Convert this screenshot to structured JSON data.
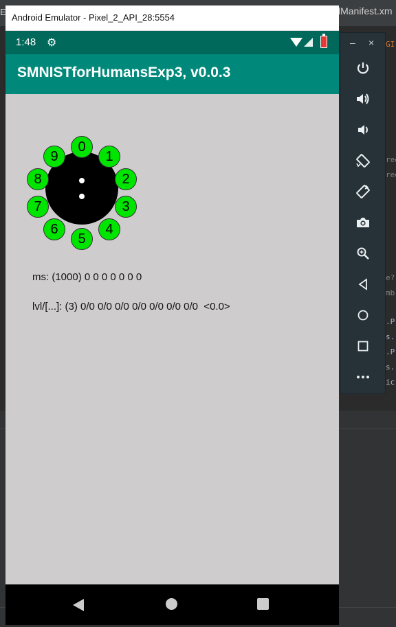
{
  "ide": {
    "left_fragment": "E",
    "tab_label": "lManifest.xm",
    "code_fragments": [
      "GI",
      "ree",
      "ree",
      "e?",
      "mb",
      ".P",
      "s.",
      ".P",
      "s.",
      "ic"
    ]
  },
  "window": {
    "title": "Android Emulator - Pixel_2_API_28:5554"
  },
  "status_bar": {
    "time": "1:48",
    "settings_icon": "gear-icon"
  },
  "app": {
    "title": "SMNISTforHumansExp3, v0.0.3"
  },
  "dial": {
    "buttons": [
      {
        "label": "0"
      },
      {
        "label": "1"
      },
      {
        "label": "2"
      },
      {
        "label": "3"
      },
      {
        "label": "4"
      },
      {
        "label": "5"
      },
      {
        "label": "6"
      },
      {
        "label": "7"
      },
      {
        "label": "8"
      },
      {
        "label": "9"
      }
    ],
    "colors": {
      "button": "#00e500",
      "center": "#000000"
    }
  },
  "stats": {
    "ms_line": "ms: (1000) 0 0 0 0 0 0 0",
    "lvl_line": "lvl/[...]: (3) 0/0 0/0 0/0 0/0 0/0 0/0 0/0  <0.0>"
  },
  "toolbar": {
    "minimize": "–",
    "close": "×",
    "buttons": [
      "power-icon",
      "volume-up-icon",
      "volume-down-icon",
      "rotate-left-icon",
      "rotate-right-icon",
      "camera-icon",
      "zoom-icon",
      "back-icon",
      "home-icon",
      "overview-icon",
      "more-icon"
    ]
  },
  "colors": {
    "status_bar": "#00695c",
    "app_bar": "#00897b",
    "background": "#cfccce"
  }
}
